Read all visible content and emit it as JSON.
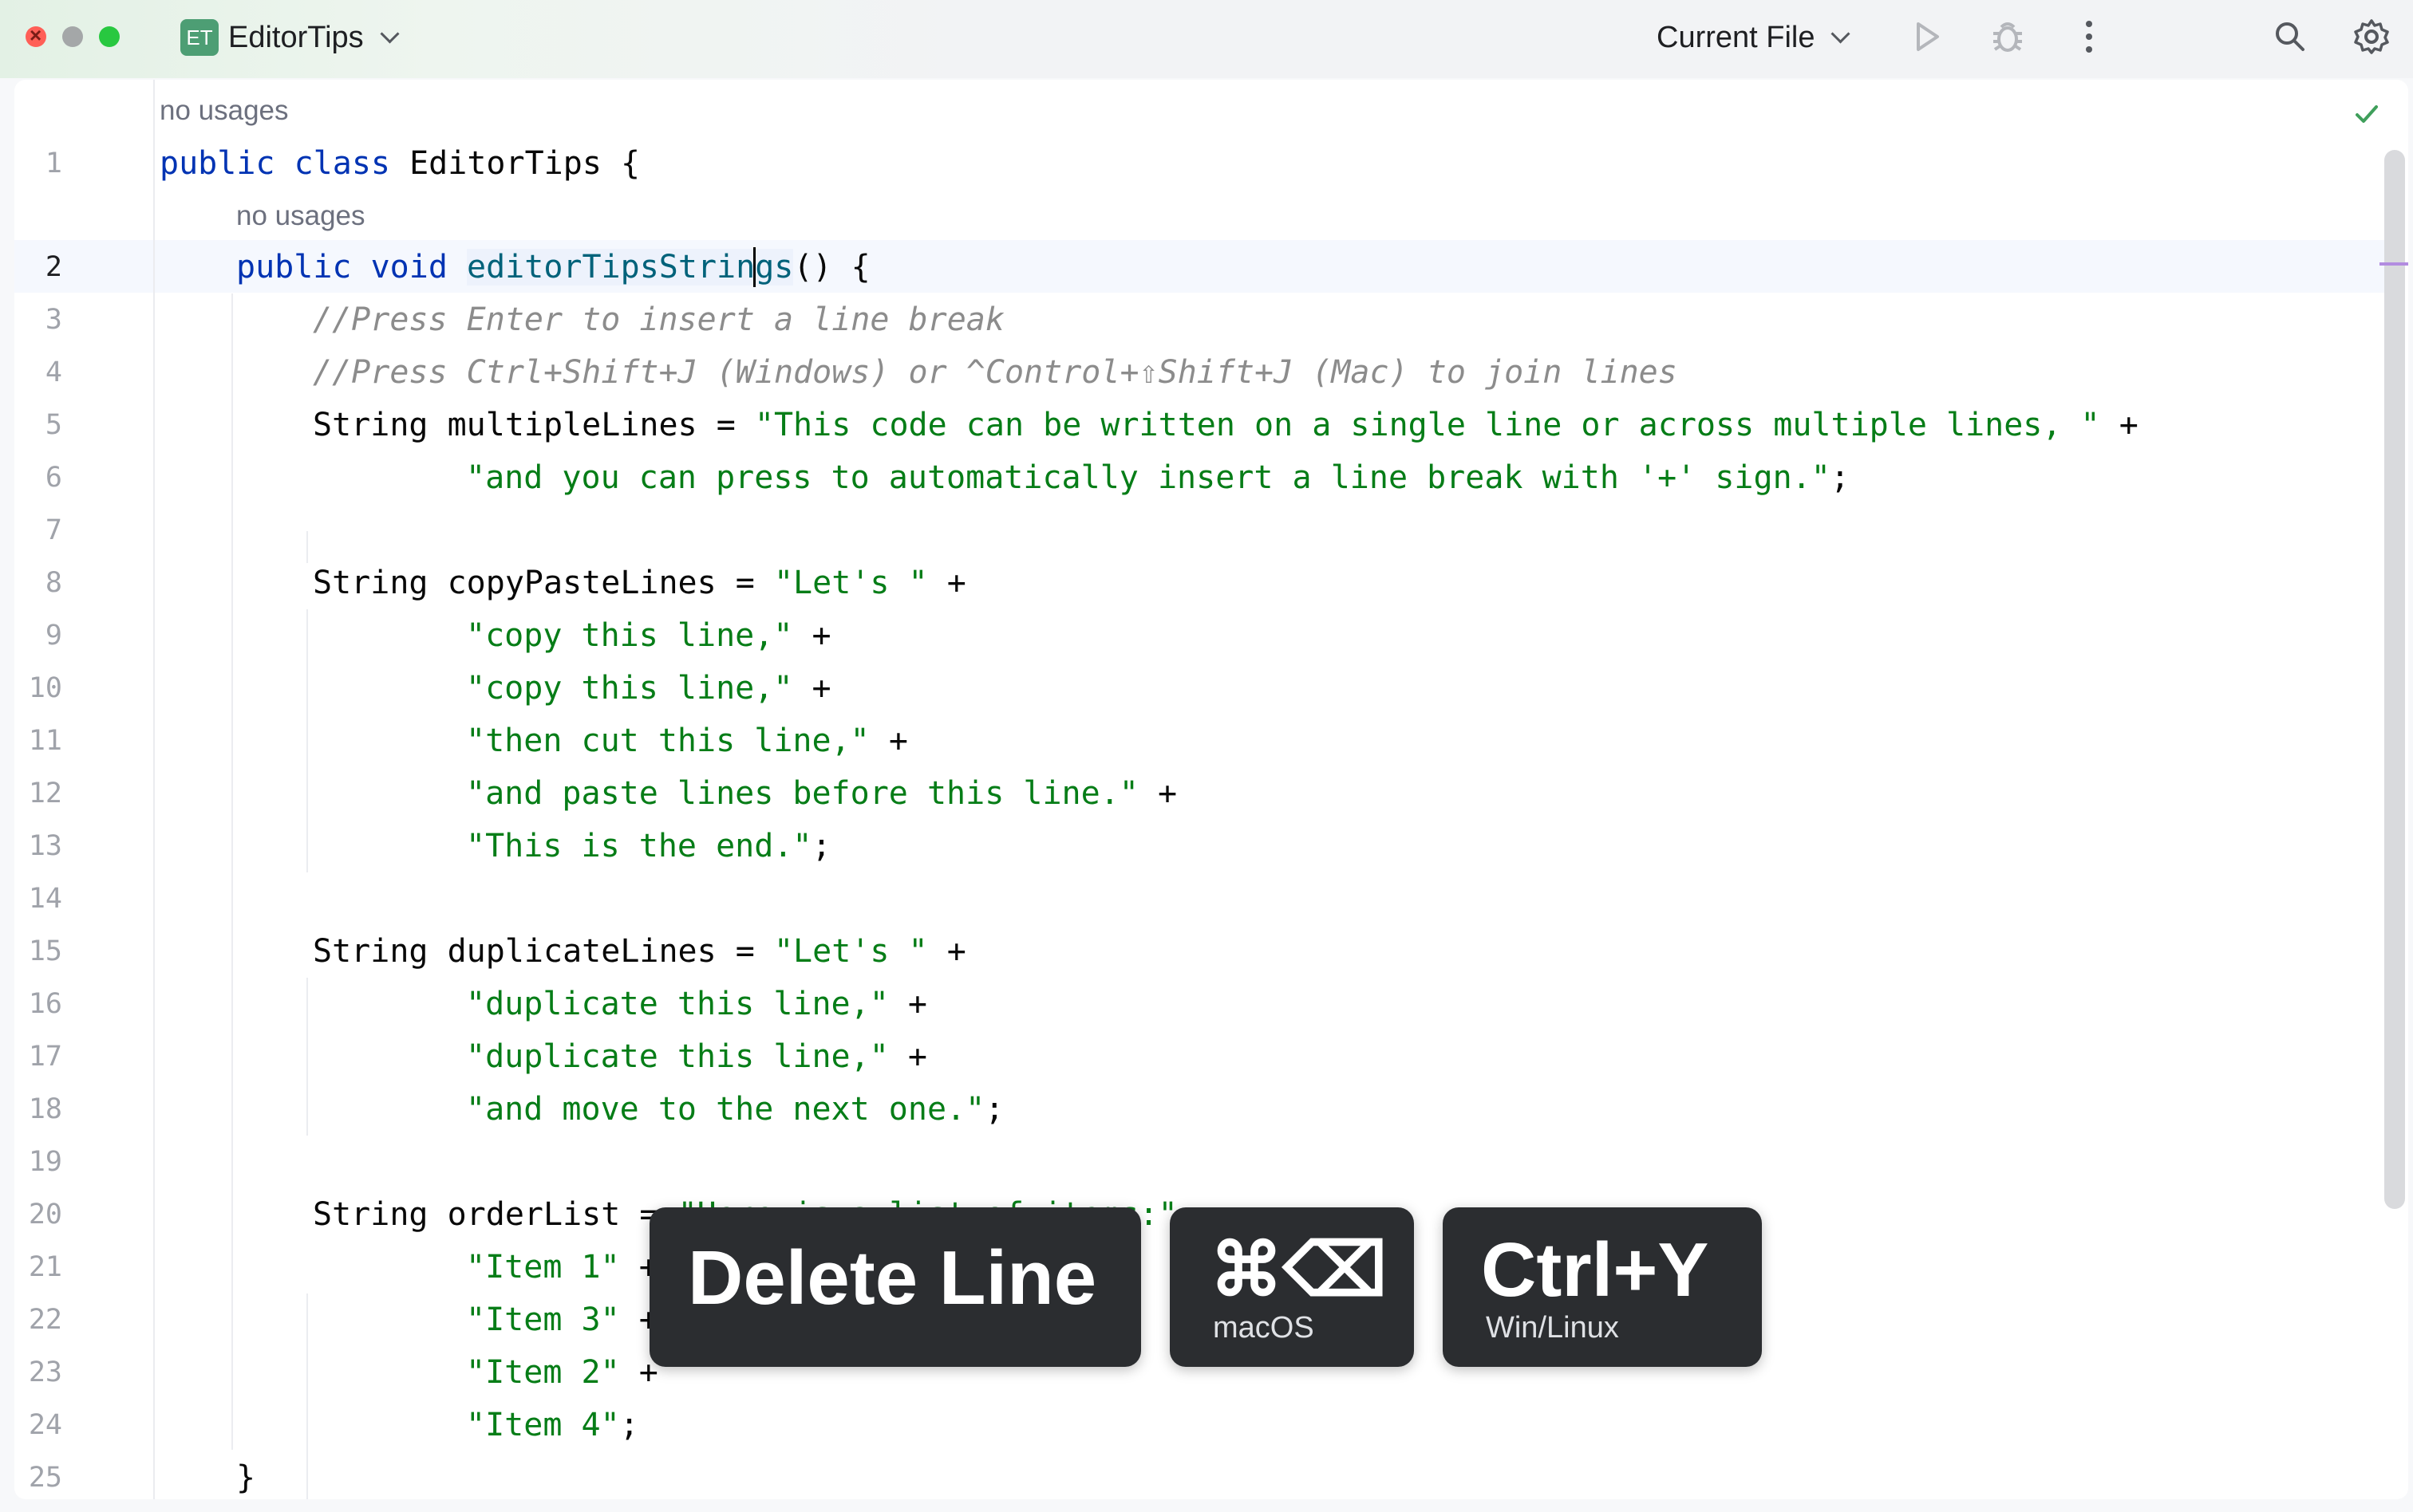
{
  "titlebar": {
    "project_badge": "ET",
    "project_name": "EditorTips",
    "run_config": "Current File",
    "icons": [
      "run-icon",
      "debug-icon",
      "more-icon",
      "search-icon",
      "settings-icon"
    ]
  },
  "editor": {
    "inlay_hints": [
      "no usages",
      "no usages"
    ],
    "line_numbers": [
      "1",
      "2",
      "3",
      "4",
      "5",
      "6",
      "7",
      "8",
      "9",
      "10",
      "11",
      "12",
      "13",
      "14",
      "15",
      "16",
      "17",
      "18",
      "19",
      "20",
      "21",
      "22",
      "23",
      "24",
      "25"
    ],
    "lines": {
      "l1_kw": "public class ",
      "l1_rest": "EditorTips {",
      "l2_kw": "public void ",
      "l2_method": "editorTipsStrings",
      "l2_rest": "() {",
      "l3": "//Press Enter to insert a line break",
      "l4": "//Press Ctrl+Shift+J (Windows) or ^Control+⇧Shift+J (Mac) to join lines",
      "l5_decl": "String multipleLines = ",
      "l5_str": "\"This code can be written on a single line or across multiple lines, \"",
      "l5_op": " +",
      "l6_str": "\"and you can press to automatically insert a line break with '+' sign.\"",
      "l6_end": ";",
      "l8_decl": "String copyPasteLines = ",
      "l8_str": "\"Let's \"",
      "l8_op": " +",
      "l9_str": "\"copy this line,\"",
      "l9_op": " +",
      "l10_str": "\"copy this line,\"",
      "l10_op": " +",
      "l11_str": "\"then cut this line,\"",
      "l11_op": " +",
      "l12_str": "\"and paste lines before this line.\"",
      "l12_op": " +",
      "l13_str": "\"This is the end.\"",
      "l13_end": ";",
      "l15_decl": "String duplicateLines = ",
      "l15_str": "\"Let's \"",
      "l15_op": " +",
      "l16_str": "\"duplicate this line,\"",
      "l16_op": " +",
      "l17_str": "\"duplicate this line,\"",
      "l17_op": " +",
      "l18_str": "\"and move to the next one.\"",
      "l18_end": ";",
      "l20_decl": "String orderList = ",
      "l20_str": "\"Here is a list of items:\"",
      "l21_str": "\"Item 1\"",
      "l21_op": " +",
      "l22_str": "\"Item 3\"",
      "l22_op": " +",
      "l23_str": "\"Item 2\"",
      "l23_op": " +",
      "l24_str": "\"Item 4\"",
      "l24_end": ";",
      "l25": "}"
    }
  },
  "key_hint": {
    "action": "Delete Line",
    "mac_keys": "⌘⌫",
    "mac_label": "macOS",
    "win_keys": "Ctrl+Y",
    "win_label": "Win/Linux"
  }
}
